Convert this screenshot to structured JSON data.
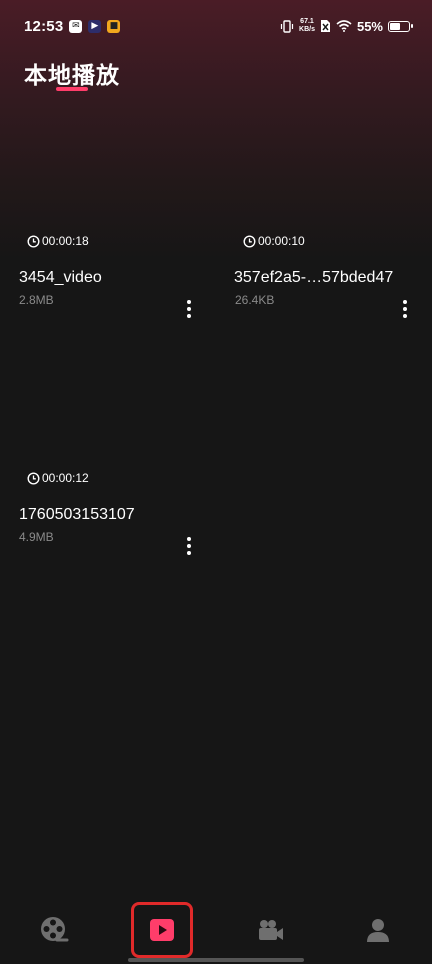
{
  "status_bar": {
    "time": "12:53",
    "net_speed_value": "67.1",
    "net_speed_unit": "KB/s",
    "battery_percent": "55%",
    "battery_level": 0.55
  },
  "header": {
    "title": "本地播放"
  },
  "videos": [
    {
      "duration": "00:00:18",
      "name": "3454_video",
      "size": "2.8MB"
    },
    {
      "duration": "00:00:10",
      "name": "357ef2a5-…57bded47",
      "size": "26.4KB"
    },
    {
      "duration": "00:00:12",
      "name": "1760503153107",
      "size": "4.9MB"
    }
  ],
  "bottom_nav": {
    "items": [
      {
        "icon": "film-reel-icon"
      },
      {
        "icon": "play-icon",
        "active": true
      },
      {
        "icon": "video-camera-icon"
      },
      {
        "icon": "person-icon"
      }
    ]
  },
  "colors": {
    "accent": "#ff3d6a",
    "highlight_box": "#e02a2a",
    "background": "#161616",
    "secondary_text": "#8a8a8a"
  }
}
